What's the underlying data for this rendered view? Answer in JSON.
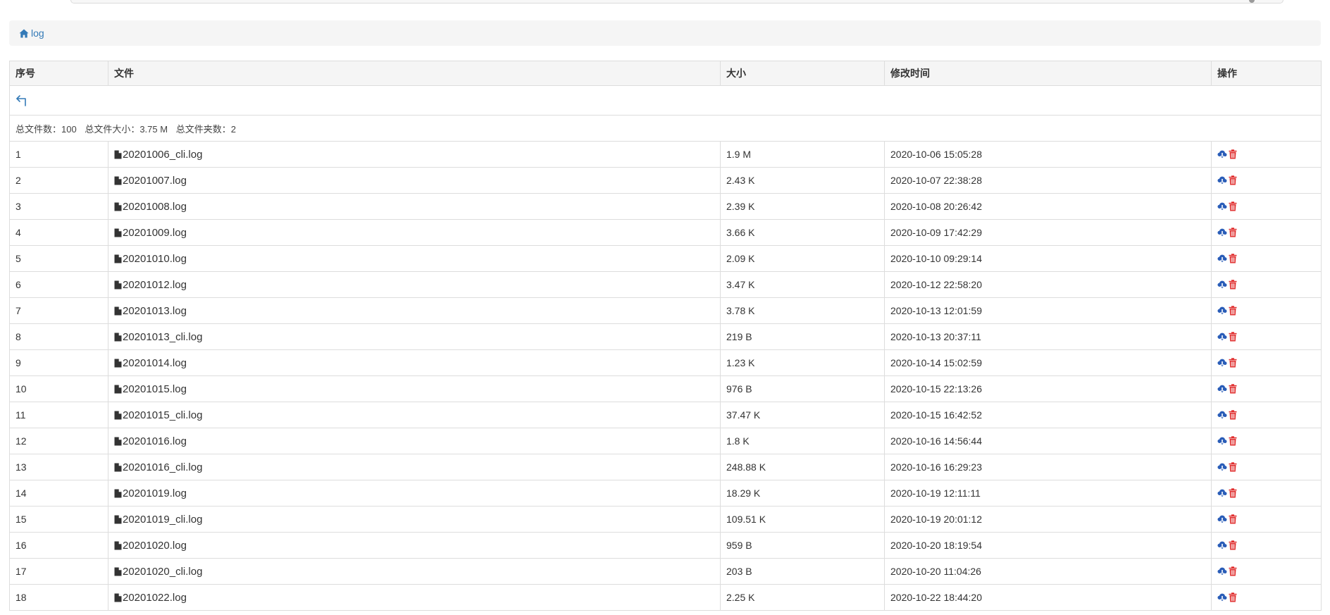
{
  "breadcrumb": {
    "home_label": "log"
  },
  "table": {
    "headers": [
      "序号",
      "文件",
      "大小",
      "修改时间",
      "操作"
    ],
    "summary": {
      "file_count": "总文件数：100",
      "total_size": "总文件大小：3.75 M",
      "folder_count": "总文件夹数：2"
    },
    "rows": [
      {
        "index": "1",
        "name": "20201006_cli.log",
        "size": "1.9 M",
        "modified": "2020-10-06 15:05:28"
      },
      {
        "index": "2",
        "name": "20201007.log",
        "size": "2.43 K",
        "modified": "2020-10-07 22:38:28"
      },
      {
        "index": "3",
        "name": "20201008.log",
        "size": "2.39 K",
        "modified": "2020-10-08 20:26:42"
      },
      {
        "index": "4",
        "name": "20201009.log",
        "size": "3.66 K",
        "modified": "2020-10-09 17:42:29"
      },
      {
        "index": "5",
        "name": "20201010.log",
        "size": "2.09 K",
        "modified": "2020-10-10 09:29:14"
      },
      {
        "index": "6",
        "name": "20201012.log",
        "size": "3.47 K",
        "modified": "2020-10-12 22:58:20"
      },
      {
        "index": "7",
        "name": "20201013.log",
        "size": "3.78 K",
        "modified": "2020-10-13 12:01:59"
      },
      {
        "index": "8",
        "name": "20201013_cli.log",
        "size": "219 B",
        "modified": "2020-10-13 20:37:11"
      },
      {
        "index": "9",
        "name": "20201014.log",
        "size": "1.23 K",
        "modified": "2020-10-14 15:02:59"
      },
      {
        "index": "10",
        "name": "20201015.log",
        "size": "976 B",
        "modified": "2020-10-15 22:13:26"
      },
      {
        "index": "11",
        "name": "20201015_cli.log",
        "size": "37.47 K",
        "modified": "2020-10-15 16:42:52"
      },
      {
        "index": "12",
        "name": "20201016.log",
        "size": "1.8 K",
        "modified": "2020-10-16 14:56:44"
      },
      {
        "index": "13",
        "name": "20201016_cli.log",
        "size": "248.88 K",
        "modified": "2020-10-16 16:29:23"
      },
      {
        "index": "14",
        "name": "20201019.log",
        "size": "18.29 K",
        "modified": "2020-10-19 12:11:11"
      },
      {
        "index": "15",
        "name": "20201019_cli.log",
        "size": "109.51 K",
        "modified": "2020-10-19 20:01:12"
      },
      {
        "index": "16",
        "name": "20201020.log",
        "size": "959 B",
        "modified": "2020-10-20 18:19:54"
      },
      {
        "index": "17",
        "name": "20201020_cli.log",
        "size": "203 B",
        "modified": "2020-10-20 11:04:26"
      },
      {
        "index": "18",
        "name": "20201022.log",
        "size": "2.25 K",
        "modified": "2020-10-22 18:44:20"
      }
    ]
  },
  "icons": {
    "home": "home-icon",
    "back": "back-arrow-icon",
    "file": "file-icon",
    "download": "cloud-download-icon",
    "delete": "trash-icon"
  },
  "colors": {
    "link": "#337ab7",
    "download": "#2a5db8",
    "delete": "#e02d2d",
    "header_bg": "#f5f5f5",
    "border": "#dddddd"
  }
}
